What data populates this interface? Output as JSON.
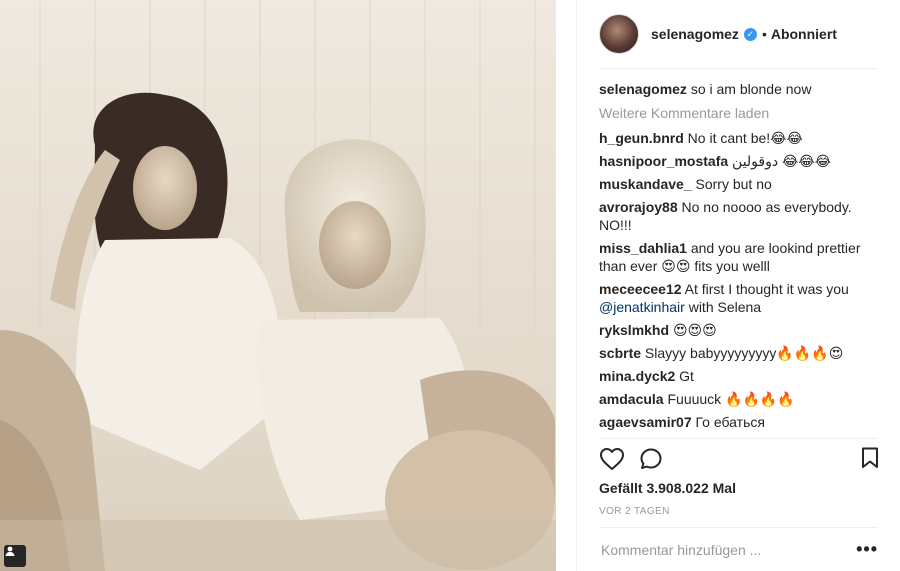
{
  "post": {
    "author": "selenagomez",
    "verified_icon": "verified-badge-icon",
    "separator": "•",
    "follow_status": "Abonniert",
    "caption_user": "selenagomez",
    "caption_text": "so i am blonde now",
    "load_more": "Weitere Kommentare laden",
    "likes": "Gefällt 3.908.022 Mal",
    "timestamp": "VOR 2 TAGEN",
    "comment_placeholder": "Kommentar hinzufügen ...",
    "more_options": "•••"
  },
  "comments": [
    {
      "user": "h_geun.bnrd",
      "text": "No it cant be!😂😂"
    },
    {
      "user": "hasnipoor_mostafa",
      "text": "دوقولین 😂😂😂"
    },
    {
      "user": "muskandave_",
      "text": "Sorry but no"
    },
    {
      "user": "avrorajoy88",
      "text": "No no noooo as everybody. NO!!!"
    },
    {
      "user": "miss_dahlia1",
      "text": "and you are lookind prettier than ever 😍😍 fits you welll"
    },
    {
      "user": "meceecee12",
      "text": "At first I thought it was you",
      "mention": "@jenatkinhair",
      "text_after": " with Selena"
    },
    {
      "user": "rykslmkhd",
      "text": "😍😍😍"
    },
    {
      "user": "scbrte",
      "text": "Slayyy babyyyyyyyyy🔥🔥🔥😍"
    },
    {
      "user": "mina.dyck2",
      "text": "Gt"
    },
    {
      "user": "amdacula",
      "text": "Fuuuuck 🔥🔥🔥🔥"
    },
    {
      "user": "agaevsamir07",
      "text": "Го ебаться"
    }
  ],
  "icons": {
    "like": "heart-outline-icon",
    "comment": "speech-bubble-icon",
    "save": "bookmark-icon",
    "tag": "user-tag-icon"
  },
  "colors": {
    "text": "#262626",
    "muted": "#999999",
    "verified": "#3897f0",
    "link": "#003569",
    "divider": "#efefef"
  }
}
